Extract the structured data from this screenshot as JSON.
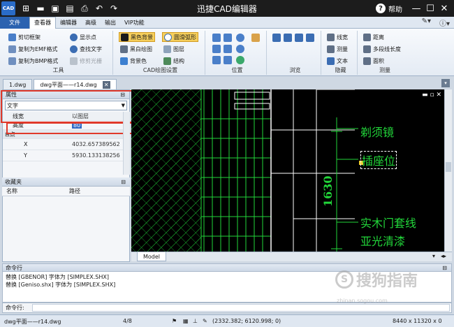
{
  "titlebar": {
    "logo": "CAD",
    "title": "迅捷CAD编辑器",
    "help": "帮助",
    "minimize": "—",
    "maximize": "☐",
    "close": "✕"
  },
  "menu": {
    "file": "文件",
    "tabs": [
      "查看器",
      "编辑器",
      "高级",
      "输出",
      "VIP功能"
    ]
  },
  "ribbon": {
    "tools": {
      "label": "工具",
      "items": [
        "剪切框架",
        "复制为EMF格式",
        "复制为BMP格式",
        "显示点",
        "查找文字",
        "修剪光栅"
      ]
    },
    "cad_settings": {
      "label": "CAD绘图设置",
      "items": [
        "黑色背景",
        "黑白绘图",
        "背景色",
        "圆滑弧形",
        "图层",
        "结构"
      ]
    },
    "position": {
      "label": "位置"
    },
    "browse": {
      "label": "浏览"
    },
    "hide": {
      "label": "隐藏",
      "items": [
        "线宽",
        "测量",
        "文本"
      ]
    },
    "measure": {
      "label": "测量",
      "items": [
        "距离",
        "多段线长度",
        "面积"
      ]
    }
  },
  "doctabs": [
    "1.dwg",
    "dwg平面——r14.dwg"
  ],
  "properties": {
    "title": "属性",
    "combo": "文字",
    "rows": [
      {
        "key": "线宽",
        "value": "以图层"
      },
      {
        "key": "高度",
        "value": "80"
      }
    ],
    "category": "点",
    "point": [
      {
        "key": "X",
        "value": "4032.657389562"
      },
      {
        "key": "Y",
        "value": "5930.133138256"
      }
    ]
  },
  "favorites": {
    "title": "收藏夹",
    "col_name": "名称",
    "col_path": "路径"
  },
  "cad": {
    "labels": [
      "剃须镜",
      "插座位",
      "1630",
      "实木门套线",
      "亚光清漆"
    ],
    "model_tab": "Model"
  },
  "command": {
    "title": "命令行",
    "lines": [
      "替换 [GBENOR] 字体为 [SIMPLEX.SHX]",
      "替换 [Geniso.shx] 字体为 [SIMPLEX.SHX]"
    ],
    "input_label": "命令行:"
  },
  "status": {
    "file": "dwg平面——r14.dwg",
    "page": "4/8",
    "coords": "(2332.382; 6120.998; 0)",
    "size": "8440 x 11320 x 0"
  },
  "watermark": {
    "text": "搜狗指南",
    "url": "zhinan.sogou.com"
  },
  "colors": {
    "cad_green": "#22d63a",
    "highlight": "#e0392a",
    "file_tab": "#2b62b0"
  }
}
